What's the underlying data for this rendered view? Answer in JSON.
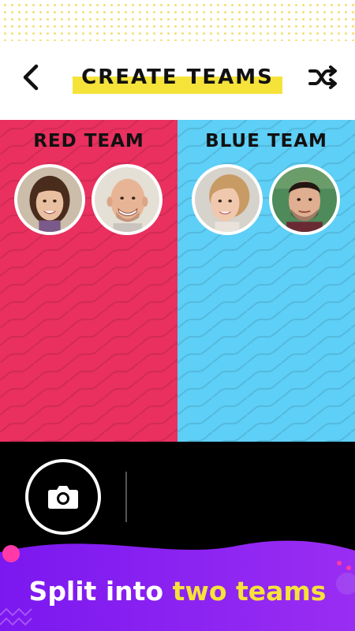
{
  "header": {
    "title": "CREATE TEAMS",
    "back_icon": "chevron-left-icon",
    "shuffle_icon": "shuffle-icon"
  },
  "teams": [
    {
      "name": "RED TEAM",
      "color": "#e9305f",
      "members": [
        "avatar-1",
        "avatar-2"
      ]
    },
    {
      "name": "BLUE TEAM",
      "color": "#5ecff6",
      "members": [
        "avatar-3",
        "avatar-4"
      ]
    }
  ],
  "camera": {
    "icon": "camera-icon"
  },
  "banner": {
    "caption_part1": "Split into ",
    "caption_part2": "two teams",
    "highlight_color": "#f6e33a",
    "background": "#8a1ef0"
  }
}
